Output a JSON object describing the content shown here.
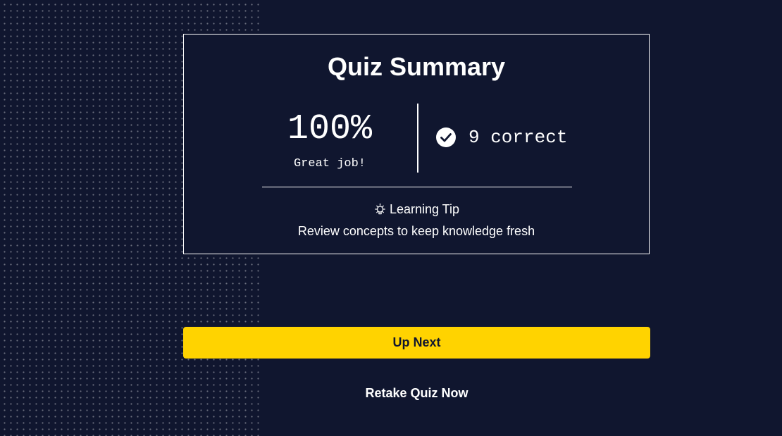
{
  "summary": {
    "title": "Quiz Summary",
    "score": "100%",
    "score_message": "Great job!",
    "correct_text": "9 correct",
    "correct_icon": "check-circle-icon",
    "tip_icon": "lightbulb-icon",
    "tip_heading": "Learning Tip",
    "tip_body": "Review concepts to keep knowledge fresh"
  },
  "actions": {
    "up_next_label": "Up Next",
    "retake_label": "Retake Quiz Now"
  },
  "colors": {
    "background": "#10162f",
    "accent": "#ffd300",
    "text": "#ffffff"
  }
}
